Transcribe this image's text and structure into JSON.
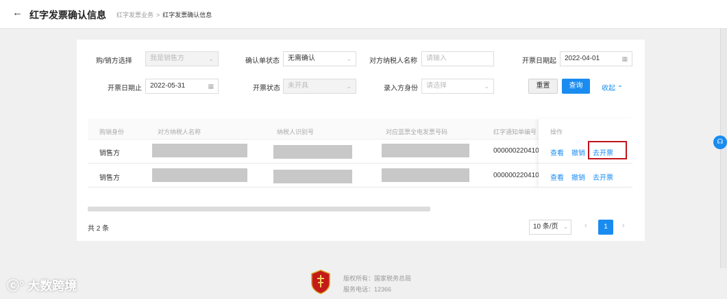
{
  "header": {
    "title": "红字发票确认信息",
    "breadcrumb": [
      "红字发票业务",
      "红字发票确认信息"
    ],
    "separator": ">"
  },
  "filters": {
    "buyer_seller": {
      "label": "购/销方选择",
      "value": "我是销售方"
    },
    "confirm_status": {
      "label": "确认单状态",
      "value": "无需确认"
    },
    "counterparty_name": {
      "label": "对方纳税人名称",
      "placeholder": "请输入"
    },
    "date_from": {
      "label": "开票日期起",
      "value": "2022-04-01"
    },
    "date_to": {
      "label": "开票日期止",
      "value": "2022-05-31"
    },
    "invoice_status": {
      "label": "开票状态",
      "value": "未开具"
    },
    "entry_identity": {
      "label": "录入方身份",
      "placeholder": "请选择"
    },
    "reset_label": "重置",
    "query_label": "查询",
    "collapse_label": "收起 ⌃"
  },
  "table": {
    "columns": [
      "购销身份",
      "对方纳税人名称",
      "纳税人识别号",
      "对应蓝票全电发票号码",
      "红字通知单编号",
      "操作"
    ],
    "rows": [
      {
        "role": "销售方",
        "notice_no": "000000220410",
        "actions": [
          "查看",
          "撤销",
          "去开票"
        ]
      },
      {
        "role": "销售方",
        "notice_no": "000000220410",
        "actions": [
          "查看",
          "撤销",
          "去开票"
        ]
      }
    ]
  },
  "pagination": {
    "total": "共 2 条",
    "page_size": "10 条/页",
    "current": "1",
    "prev": "‹",
    "next": "›"
  },
  "footer": {
    "copyright": "版权所有：国家税务总局",
    "hotline": "服务电话：12366"
  },
  "watermark": "大数跨境",
  "colors": {
    "accent": "#1a8cf0",
    "highlight": "#c0121a"
  }
}
